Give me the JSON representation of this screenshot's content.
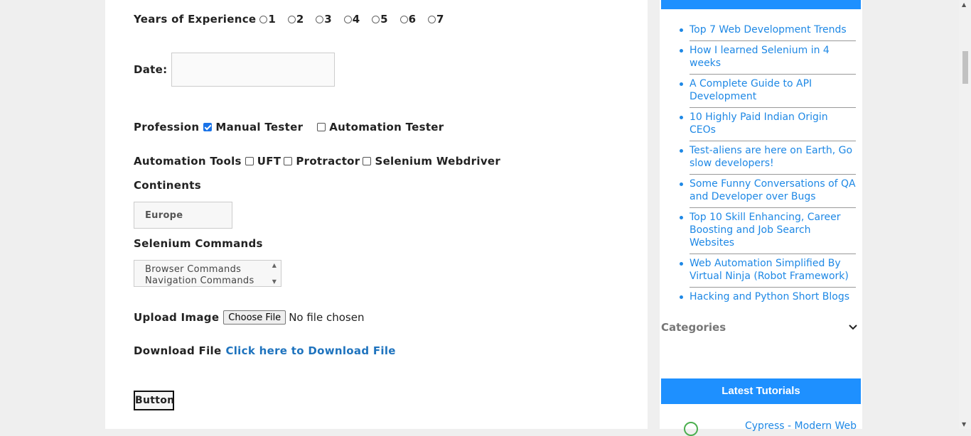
{
  "form": {
    "experience": {
      "label": "Years of Experience",
      "options": [
        "1",
        "2",
        "3",
        "4",
        "5",
        "6",
        "7"
      ]
    },
    "date": {
      "label": "Date:",
      "value": ""
    },
    "profession": {
      "label": "Profession",
      "options": [
        {
          "label": "Manual Tester",
          "checked": true
        },
        {
          "label": "Automation Tester",
          "checked": false
        }
      ]
    },
    "tools": {
      "label": "Automation Tools",
      "options": [
        "UFT",
        "Protractor",
        "Selenium Webdriver"
      ]
    },
    "continents": {
      "label": "Continents",
      "selected": "Europe"
    },
    "selenium_commands": {
      "label": "Selenium Commands",
      "options": [
        "Browser Commands",
        "Navigation Commands"
      ]
    },
    "upload": {
      "label": "Upload Image",
      "button": "Choose File",
      "status": "No file chosen"
    },
    "download": {
      "label": "Download File",
      "link": "Click here to Download File"
    },
    "button": {
      "label": "Button"
    }
  },
  "sidebar": {
    "blogs": [
      "Top 7 Web Development Trends",
      "How I learned Selenium in 4 weeks",
      "A Complete Guide to API Development",
      "10 Highly Paid Indian Origin CEOs",
      "Test-aliens are here on Earth, Go slow developers!",
      "Some Funny Conversations of QA and Developer over Bugs",
      "Top 10 Skill Enhancing, Career Boosting and Job Search Websites",
      "Web Automation Simplified By Virtual Ninja (Robot Framework)",
      "Hacking and Python Short Blogs"
    ],
    "categories_title": "Categories",
    "latest_tutorials_title": "Latest Tutorials",
    "latest_tutorial_item": "Cypress - Modern Web"
  },
  "colors": {
    "accent": "#1e90ff",
    "link": "#1e88e5",
    "page_bg": "#efefef"
  }
}
